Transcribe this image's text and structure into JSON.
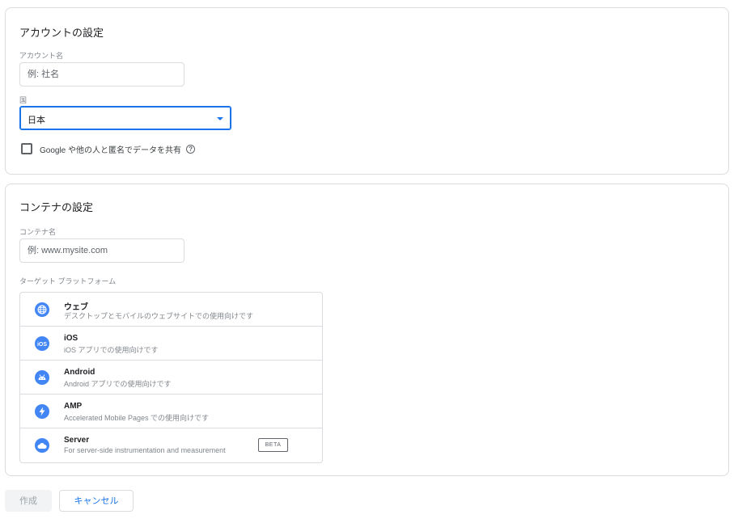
{
  "account_section": {
    "title": "アカウントの設定",
    "name_label": "アカウント名",
    "name_placeholder": "例: 社名",
    "name_value": "",
    "country_label": "国",
    "country_value": "日本",
    "share_data_label": "Google や他の人と匿名でデータを共有",
    "share_data_checked": false
  },
  "container_section": {
    "title": "コンテナの設定",
    "name_label": "コンテナ名",
    "name_placeholder": "例: www.mysite.com",
    "name_value": "",
    "platform_label": "ターゲット プラットフォーム",
    "platforms": [
      {
        "name": "ウェブ",
        "description": "デスクトップとモバイルのウェブサイトでの使用向けです",
        "icon": "globe-icon",
        "badge": ""
      },
      {
        "name": "iOS",
        "description": "iOS アプリでの使用向けです",
        "icon": "ios-icon",
        "badge": ""
      },
      {
        "name": "Android",
        "description": "Android アプリでの使用向けです",
        "icon": "android-icon",
        "badge": ""
      },
      {
        "name": "AMP",
        "description": "Accelerated Mobile Pages での使用向けです",
        "icon": "amp-lightning-icon",
        "badge": ""
      },
      {
        "name": "Server",
        "description": "For server-side instrumentation and measurement",
        "icon": "cloud-icon",
        "badge": "BETA"
      }
    ]
  },
  "actions": {
    "create_label": "作成",
    "cancel_label": "キャンセル"
  },
  "colors": {
    "accent": "#1a73e8",
    "icon_blue": "#4285f4",
    "border": "#dadce0"
  }
}
